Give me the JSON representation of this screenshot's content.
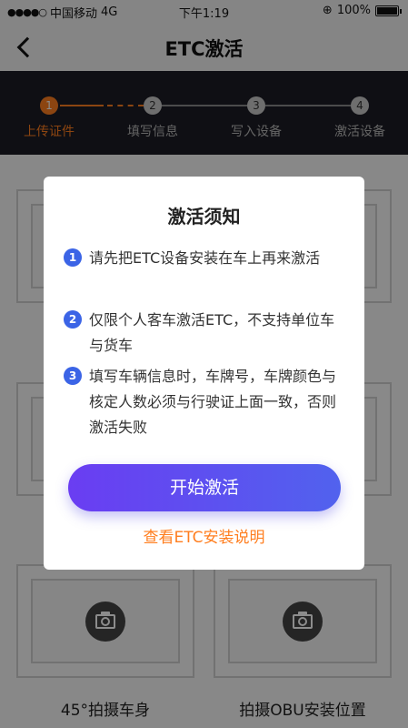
{
  "status_bar": {
    "signal": "●●●●○",
    "carrier": "中国移动",
    "network": "4G",
    "time": "下午1:19",
    "battery_text": "100%",
    "battery_level": 1.0
  },
  "nav": {
    "title": "ETC激活",
    "back_icon": "back-chevron-icon"
  },
  "steps": [
    {
      "num": "1",
      "label": "上传证件",
      "active": true
    },
    {
      "num": "2",
      "label": "填写信息",
      "active": false
    },
    {
      "num": "3",
      "label": "写入设备",
      "active": false
    },
    {
      "num": "4",
      "label": "激活设备",
      "active": false
    }
  ],
  "photo_cards": [
    {
      "caption": ""
    },
    {
      "caption": ""
    },
    {
      "caption": ""
    },
    {
      "caption": ""
    },
    {
      "caption": "45°拍摄车身"
    },
    {
      "caption": "拍摄OBU安装位置"
    }
  ],
  "modal": {
    "title": "激活须知",
    "notices": [
      {
        "num": "1",
        "text": "请先把ETC设备安装在车上再来激活"
      },
      {
        "num": "2",
        "text": "仅限个人客车激活ETC，不支持单位车与货车"
      },
      {
        "num": "3",
        "text": "填写车辆信息时，车牌号，车牌颜色与核定人数必须与行驶证上面一致，否则激活失败"
      }
    ],
    "start_button": "开始激活",
    "guide_link": "查看ETC安装说明"
  },
  "colors": {
    "accent_orange": "#ff7e1f",
    "button_purple": "#6a3df2",
    "notice_blue": "#3b64e6",
    "stepper_bg": "#1d1d25"
  }
}
